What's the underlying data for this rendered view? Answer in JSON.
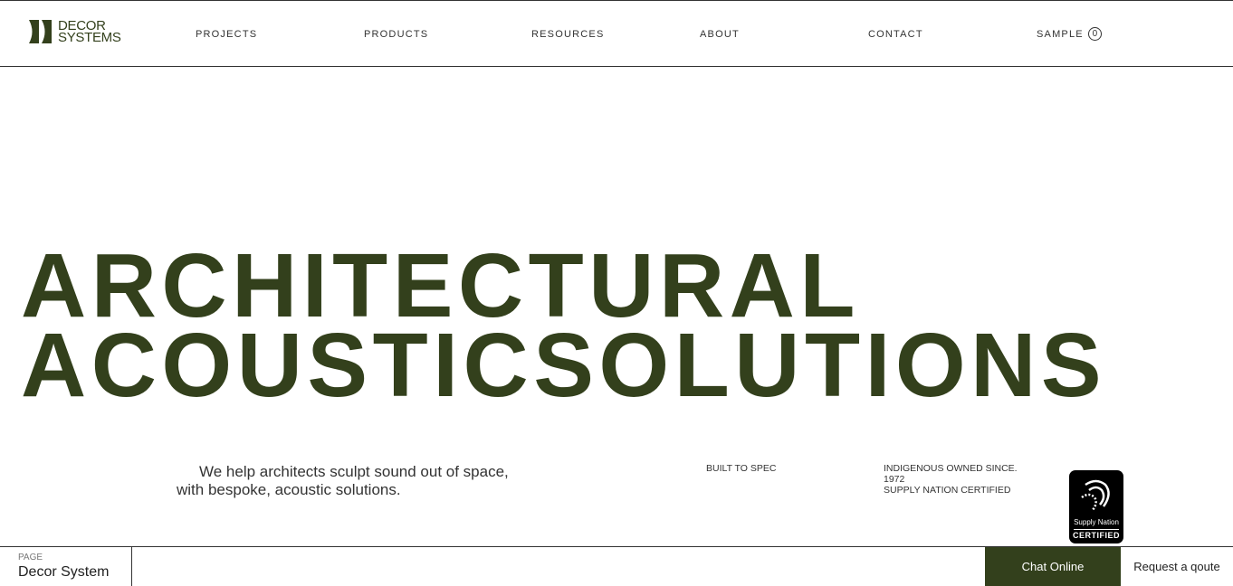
{
  "brand": {
    "line1": "DECOR",
    "line2": "SYSTEMS"
  },
  "nav": [
    {
      "label": "PROJECTS"
    },
    {
      "label": "PRODUCTS"
    },
    {
      "label": "RESOURCES"
    },
    {
      "label": "ABOUT"
    },
    {
      "label": "CONTACT"
    }
  ],
  "sample": {
    "label": "SAMPLE",
    "count": "0"
  },
  "hero": {
    "line1": "ARCHITECTURAL",
    "line2": "ACOUSTICSOLUTIONS"
  },
  "tagline": "We help architects sculpt sound out of space, with bespoke, acoustic solutions.",
  "built": "BUILT TO SPEC",
  "indigenous": {
    "line1": "INDIGENOUS OWNED SINCE.",
    "line2": "1972",
    "line3": "SUPPLY NATION CERTIFIED"
  },
  "cert": {
    "name": "Supply Nation",
    "status": "CERTIFIED"
  },
  "footer": {
    "page_label": "PAGE",
    "page_name": "Decor System",
    "chat": "Chat Online",
    "quote": "Request a qoute"
  },
  "colors": {
    "accent": "#33401c"
  }
}
